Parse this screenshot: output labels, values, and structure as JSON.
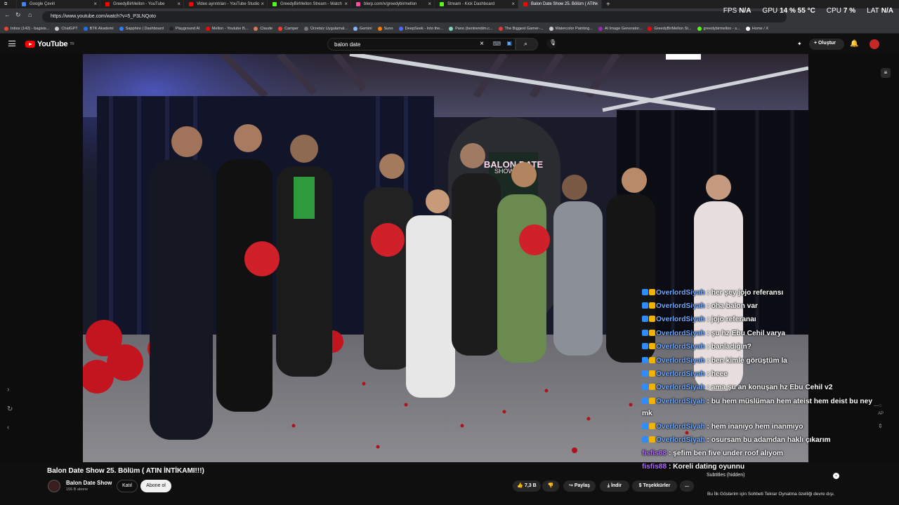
{
  "browser": {
    "tabs": [
      {
        "title": "Google Çeviri",
        "favicon_color": "#4285f4",
        "active": false
      },
      {
        "title": "GreedyBirMellon - YouTube",
        "favicon_color": "#ff0000",
        "active": false
      },
      {
        "title": "Video ayrıntıları - YouTube Studio",
        "favicon_color": "#ff0000",
        "active": false
      },
      {
        "title": "GreedyBirMellon Stream - Watch",
        "favicon_color": "#53fc18",
        "active": false
      },
      {
        "title": "blerp.com/x/greedybirmellon",
        "favicon_color": "#ff4aa0",
        "active": false
      },
      {
        "title": "Stream - Kick Dashboard",
        "favicon_color": "#53fc18",
        "active": false
      },
      {
        "title": "Balon Date Show 25. Bölüm ( ATIN",
        "favicon_color": "#ff0000",
        "active": true
      }
    ],
    "url": "https://www.youtube.com/watch?v=5_P3LNQoto",
    "bookmarks": [
      {
        "label": "Inbox (142) - bagisis...",
        "color": "#ea4335"
      },
      {
        "label": "ChatGPT",
        "color": "#cccccc"
      },
      {
        "label": "BTK Akademi",
        "color": "#1a73e8"
      },
      {
        "label": "Sapphire | Dashboard",
        "color": "#2d7ff9"
      },
      {
        "label": "Playground AI",
        "color": "#222222"
      },
      {
        "label": "Mellon - Youtube B...",
        "color": "#ff0000"
      },
      {
        "label": "Claude",
        "color": "#d97757"
      },
      {
        "label": "Camper",
        "color": "#ff3b30"
      },
      {
        "label": "Ücretsiz Uygulamal...",
        "color": "#777777"
      },
      {
        "label": "Gemini",
        "color": "#8ab4f8"
      },
      {
        "label": "Suno",
        "color": "#ff7a00"
      },
      {
        "label": "DeepSeek - Into the...",
        "color": "#4d6bfe"
      },
      {
        "label": "Pano (bentrendim.c...",
        "color": "#7dd3c0"
      },
      {
        "label": "The Biggest Gamer-...",
        "color": "#e53935"
      },
      {
        "label": "Watercolor Painting...",
        "color": "#cccccc"
      },
      {
        "label": "AI Image Generator...",
        "color": "#9c27b0"
      },
      {
        "label": "GreedyBirMellon St...",
        "color": "#ff0000"
      },
      {
        "label": "greedybirmellon - s...",
        "color": "#53fc18"
      },
      {
        "label": "Home / X",
        "color": "#ffffff"
      }
    ]
  },
  "perf_overlay": {
    "fps_label": "FPS",
    "fps_value": "N/A",
    "gpu_label": "GPU",
    "gpu_value": "14 % 55 °C",
    "cpu_label": "CPU",
    "cpu_value": "7 %",
    "lat_label": "LAT",
    "lat_value": "N/A"
  },
  "youtube": {
    "logo_text": "YouTube",
    "region": "TR",
    "search_query": "balon date",
    "create_label": "Oluştur"
  },
  "chat": [
    {
      "user": "OverlordSiyah",
      "message": ": her şey jojo referansı",
      "purple": false
    },
    {
      "user": "OverlordSiyah",
      "message": ": oha balon var",
      "purple": false
    },
    {
      "user": "OverlordSiyah",
      "message": ": jojo referanaı",
      "purple": false
    },
    {
      "user": "OverlordSiyah",
      "message": ": şu hz Ebu Cehil varya",
      "purple": false
    },
    {
      "user": "OverlordSiyah",
      "message": ": banladığın?",
      "purple": false
    },
    {
      "user": "OverlordSiyah",
      "message": ": ben kimle görüştüm la",
      "purple": false
    },
    {
      "user": "OverlordSiyah",
      "message": ": heee",
      "purple": false
    },
    {
      "user": "OverlordSiyah",
      "message": ": ama şu an konuşan hz Ebu Cehil v2",
      "purple": false
    },
    {
      "user": "OverlordSiyah",
      "message": ": bu hem müslüman hem ateist hem deist bu ney",
      "purple": false,
      "continuation": "mk"
    },
    {
      "user": "OverlordSiyah",
      "message": ": hem inanıyo hem inanmıyo",
      "purple": false
    },
    {
      "user": "OverlordSiyah",
      "message": ": osursam bu adamdan haklı çıkarım",
      "purple": false
    },
    {
      "user": "fisfis88",
      "message": ": şefim ben five under roof alıyom",
      "purple": true
    },
    {
      "user": "fisfis88",
      "message": ": Koreli dating oyunnu",
      "purple": true
    }
  ],
  "video": {
    "title": "Balon Date Show 25. Bölüm ( ATIN İNTİKAMI!!!)",
    "sign_text": "BALON DATE",
    "sign_sub": "SHOW",
    "channel_name": "Balon Date Show",
    "subscribers": "156 B abone",
    "join_label": "Katıl",
    "subscribe_label": "Abone ol",
    "likes": "7,3 B",
    "share_label": "Paylaş",
    "download_label": "İndir",
    "thanks_label": "Teşekkürler",
    "more_label": "..."
  },
  "subtitles_panel": {
    "header": "Subtitles (hidden)",
    "note": "Bu İlk Gösterim için Sohbeti Tekrar Oynatma özelliği devre dışı."
  },
  "side_label": "AP"
}
